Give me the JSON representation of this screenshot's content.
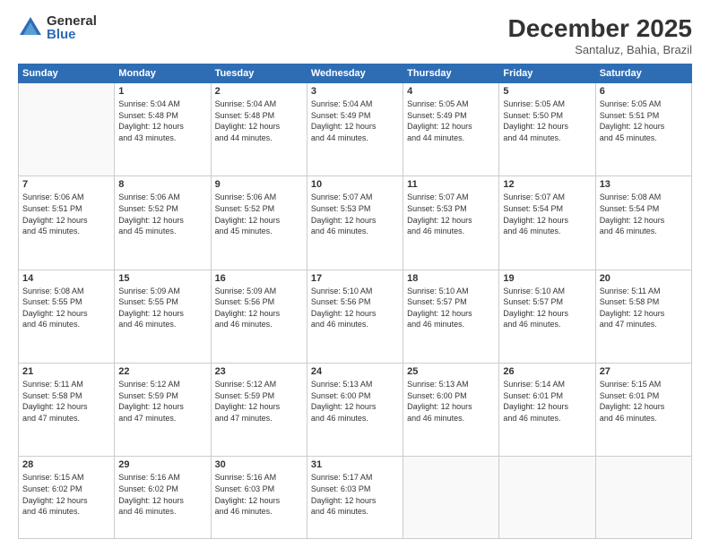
{
  "logo": {
    "general": "General",
    "blue": "Blue"
  },
  "title": "December 2025",
  "subtitle": "Santaluz, Bahia, Brazil",
  "days": [
    "Sunday",
    "Monday",
    "Tuesday",
    "Wednesday",
    "Thursday",
    "Friday",
    "Saturday"
  ],
  "weeks": [
    [
      {
        "day": "",
        "info": ""
      },
      {
        "day": "1",
        "info": "Sunrise: 5:04 AM\nSunset: 5:48 PM\nDaylight: 12 hours\nand 43 minutes."
      },
      {
        "day": "2",
        "info": "Sunrise: 5:04 AM\nSunset: 5:48 PM\nDaylight: 12 hours\nand 44 minutes."
      },
      {
        "day": "3",
        "info": "Sunrise: 5:04 AM\nSunset: 5:49 PM\nDaylight: 12 hours\nand 44 minutes."
      },
      {
        "day": "4",
        "info": "Sunrise: 5:05 AM\nSunset: 5:49 PM\nDaylight: 12 hours\nand 44 minutes."
      },
      {
        "day": "5",
        "info": "Sunrise: 5:05 AM\nSunset: 5:50 PM\nDaylight: 12 hours\nand 44 minutes."
      },
      {
        "day": "6",
        "info": "Sunrise: 5:05 AM\nSunset: 5:51 PM\nDaylight: 12 hours\nand 45 minutes."
      }
    ],
    [
      {
        "day": "7",
        "info": "Sunrise: 5:06 AM\nSunset: 5:51 PM\nDaylight: 12 hours\nand 45 minutes."
      },
      {
        "day": "8",
        "info": "Sunrise: 5:06 AM\nSunset: 5:52 PM\nDaylight: 12 hours\nand 45 minutes."
      },
      {
        "day": "9",
        "info": "Sunrise: 5:06 AM\nSunset: 5:52 PM\nDaylight: 12 hours\nand 45 minutes."
      },
      {
        "day": "10",
        "info": "Sunrise: 5:07 AM\nSunset: 5:53 PM\nDaylight: 12 hours\nand 46 minutes."
      },
      {
        "day": "11",
        "info": "Sunrise: 5:07 AM\nSunset: 5:53 PM\nDaylight: 12 hours\nand 46 minutes."
      },
      {
        "day": "12",
        "info": "Sunrise: 5:07 AM\nSunset: 5:54 PM\nDaylight: 12 hours\nand 46 minutes."
      },
      {
        "day": "13",
        "info": "Sunrise: 5:08 AM\nSunset: 5:54 PM\nDaylight: 12 hours\nand 46 minutes."
      }
    ],
    [
      {
        "day": "14",
        "info": "Sunrise: 5:08 AM\nSunset: 5:55 PM\nDaylight: 12 hours\nand 46 minutes."
      },
      {
        "day": "15",
        "info": "Sunrise: 5:09 AM\nSunset: 5:55 PM\nDaylight: 12 hours\nand 46 minutes."
      },
      {
        "day": "16",
        "info": "Sunrise: 5:09 AM\nSunset: 5:56 PM\nDaylight: 12 hours\nand 46 minutes."
      },
      {
        "day": "17",
        "info": "Sunrise: 5:10 AM\nSunset: 5:56 PM\nDaylight: 12 hours\nand 46 minutes."
      },
      {
        "day": "18",
        "info": "Sunrise: 5:10 AM\nSunset: 5:57 PM\nDaylight: 12 hours\nand 46 minutes."
      },
      {
        "day": "19",
        "info": "Sunrise: 5:10 AM\nSunset: 5:57 PM\nDaylight: 12 hours\nand 46 minutes."
      },
      {
        "day": "20",
        "info": "Sunrise: 5:11 AM\nSunset: 5:58 PM\nDaylight: 12 hours\nand 47 minutes."
      }
    ],
    [
      {
        "day": "21",
        "info": "Sunrise: 5:11 AM\nSunset: 5:58 PM\nDaylight: 12 hours\nand 47 minutes."
      },
      {
        "day": "22",
        "info": "Sunrise: 5:12 AM\nSunset: 5:59 PM\nDaylight: 12 hours\nand 47 minutes."
      },
      {
        "day": "23",
        "info": "Sunrise: 5:12 AM\nSunset: 5:59 PM\nDaylight: 12 hours\nand 47 minutes."
      },
      {
        "day": "24",
        "info": "Sunrise: 5:13 AM\nSunset: 6:00 PM\nDaylight: 12 hours\nand 46 minutes."
      },
      {
        "day": "25",
        "info": "Sunrise: 5:13 AM\nSunset: 6:00 PM\nDaylight: 12 hours\nand 46 minutes."
      },
      {
        "day": "26",
        "info": "Sunrise: 5:14 AM\nSunset: 6:01 PM\nDaylight: 12 hours\nand 46 minutes."
      },
      {
        "day": "27",
        "info": "Sunrise: 5:15 AM\nSunset: 6:01 PM\nDaylight: 12 hours\nand 46 minutes."
      }
    ],
    [
      {
        "day": "28",
        "info": "Sunrise: 5:15 AM\nSunset: 6:02 PM\nDaylight: 12 hours\nand 46 minutes."
      },
      {
        "day": "29",
        "info": "Sunrise: 5:16 AM\nSunset: 6:02 PM\nDaylight: 12 hours\nand 46 minutes."
      },
      {
        "day": "30",
        "info": "Sunrise: 5:16 AM\nSunset: 6:03 PM\nDaylight: 12 hours\nand 46 minutes."
      },
      {
        "day": "31",
        "info": "Sunrise: 5:17 AM\nSunset: 6:03 PM\nDaylight: 12 hours\nand 46 minutes."
      },
      {
        "day": "",
        "info": ""
      },
      {
        "day": "",
        "info": ""
      },
      {
        "day": "",
        "info": ""
      }
    ]
  ]
}
